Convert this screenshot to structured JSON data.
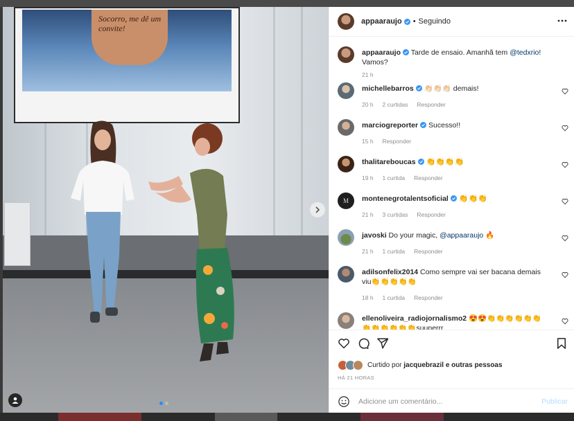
{
  "post": {
    "username": "appaaraujo",
    "follow_status": "Seguindo",
    "separator": "•",
    "caption_text": "Tarde de ensaio. Amanhã tem",
    "caption_mention": "@tedxrio",
    "caption_tail": "! Vamos?",
    "caption_time": "21 h",
    "screen_text": "Socorro, me dê um convite!"
  },
  "comments": [
    {
      "username": "michellebarros",
      "verified": true,
      "text": "👏🏻👏🏻👏🏻 demais!",
      "time": "20 h",
      "likes": "2 curtidas",
      "reply": "Responder"
    },
    {
      "username": "marciogreporter",
      "verified": true,
      "text": "Sucesso!!",
      "time": "15 h",
      "likes": "",
      "reply": "Responder"
    },
    {
      "username": "thalitareboucas",
      "verified": true,
      "text": "👏👏👏👏",
      "time": "19 h",
      "likes": "1 curtida",
      "reply": "Responder"
    },
    {
      "username": "montenegrotalentsoficial",
      "verified": true,
      "text": "👏👏👏",
      "time": "21 h",
      "likes": "3 curtidas",
      "reply": "Responder"
    },
    {
      "username": "javoski",
      "verified": false,
      "text": "Do your magic,",
      "mention": "@appaaraujo",
      "tail": "🔥",
      "time": "21 h",
      "likes": "1 curtida",
      "reply": "Responder"
    },
    {
      "username": "adilsonfelix2014",
      "verified": false,
      "text": "Como sempre vai ser bacana demais viu👏👏👏👏👏",
      "time": "18 h",
      "likes": "1 curtida",
      "reply": "Responder"
    },
    {
      "username": "ellenoliveira_radiojornalismo2",
      "verified": false,
      "text": "😍😍👏👏👏👏👏👏👏👏👏👏👏👏suuperrr",
      "time": "",
      "likes": "",
      "reply": ""
    }
  ],
  "likes_summary": {
    "prefix": "Curtido por",
    "user": "jacquebrazil",
    "suffix": "e outras pessoas"
  },
  "timestamp": "HÁ 21 HORAS",
  "composer": {
    "placeholder": "Adicione um comentário...",
    "publish_label": "Publicar"
  },
  "icons": {
    "like": "heart-icon",
    "comment": "comment-icon",
    "share": "share-icon",
    "save": "bookmark-icon",
    "more": "more-icon",
    "emoji": "emoji-icon",
    "next": "chevron-right-icon",
    "tag": "user-tag-icon"
  },
  "colors": {
    "verified": "#3897f0",
    "link": "#00376b",
    "muted": "#8e8e8e",
    "publish_disabled": "#b3dbff",
    "carousel_active": "#1e90ff"
  }
}
